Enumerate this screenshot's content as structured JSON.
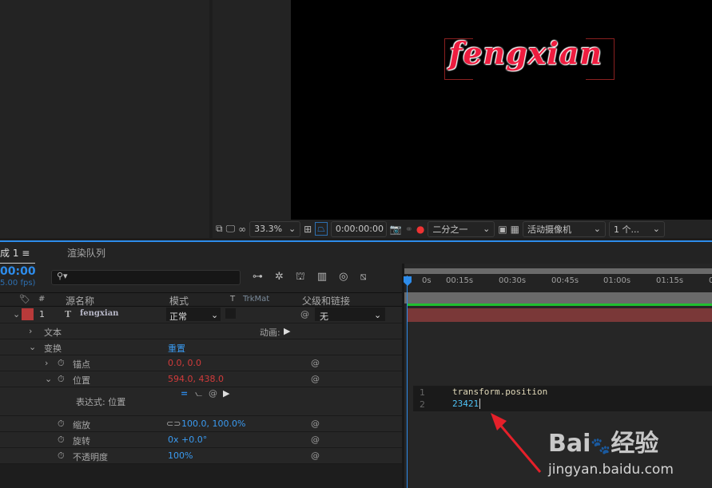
{
  "viewer": {
    "comp_text": "fengxian",
    "toolbar": {
      "zoom": "33.3%",
      "timecode": "0:00:00:00",
      "resolution": "二分之一",
      "camera": "活动摄像机",
      "views": "1 个..."
    }
  },
  "tabs": {
    "comp": "成 1",
    "render_queue": "渲染队列"
  },
  "timeline": {
    "timecode": "00:00",
    "fps": "5.00 fps)",
    "search_placeholder": "",
    "columns": {
      "num": "#",
      "source": "源名称",
      "mode": "模式",
      "t": "T",
      "trkmat": "TrkMat",
      "parent": "父级和链接"
    },
    "layer": {
      "index": "1",
      "name": "fengxian",
      "mode": "正常",
      "parent": "无",
      "label_color": "#b83a3a"
    },
    "props": {
      "text": "文本",
      "animate": "动画:",
      "transform": "变换",
      "reset": "重置",
      "anchor": "锚点",
      "anchor_val": "0.0, 0.0",
      "position": "位置",
      "position_val": "594.0, 438.0",
      "expression": "表达式: 位置",
      "scale": "缩放",
      "scale_val": "100.0, 100.0%",
      "rotation": "旋转",
      "rotation_val": "0x +0.0°",
      "opacity": "不透明度",
      "opacity_val": "100%"
    },
    "ruler": [
      "0s",
      "00:15s",
      "00:30s",
      "00:45s",
      "01:00s",
      "01:15s",
      "0"
    ],
    "expression_code": {
      "line1_num": "1",
      "line1": "transform.position",
      "line2_num": "2",
      "line2": "23421"
    }
  },
  "watermark": {
    "brand": "Bai 经验",
    "url": "jingyan.baidu.com"
  },
  "colors": {
    "accent": "#2d8ceb",
    "layer_bar": "#7a3838",
    "work_area": "#1fbf2f",
    "value_red": "#d33b3b",
    "value_blue": "#3a9af0"
  }
}
